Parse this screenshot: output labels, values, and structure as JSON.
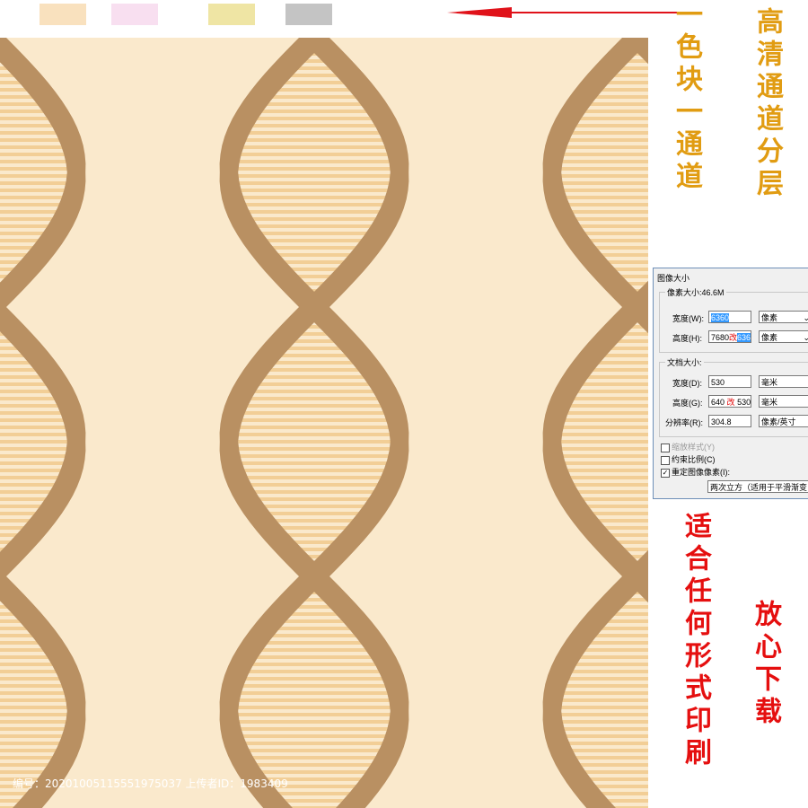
{
  "swatches": [
    {
      "name": "swatch-cream",
      "color": "#f9e1be"
    },
    {
      "name": "swatch-pink",
      "color": "#f8dff0"
    },
    {
      "name": "swatch-yellow",
      "color": "#efe5a4"
    },
    {
      "name": "swatch-gray",
      "color": "#c4c4c4"
    }
  ],
  "arrow_color": "#e0121a",
  "pattern": {
    "background": "#fae9cc",
    "band_color": "#b99062",
    "stripe_color": "#f1c98d"
  },
  "side_text": {
    "left_top": "一色块一通道",
    "right_top": "高清通道分层",
    "left_bottom": "适合任何形式印刷",
    "right_bottom": "放心下载",
    "gold_color": "#e19c12",
    "red_color": "#e50f0f"
  },
  "dialog": {
    "title": "图像大小",
    "pixel_dims_label": "像素大小:46.6M",
    "width_label": "宽度(W):",
    "width_value": "6360",
    "width_unit": "像素",
    "height_label": "高度(H):",
    "height_old": "7680",
    "height_arrow": "改",
    "height_value": "6360",
    "height_unit": "像素",
    "doc_size_label": "文档大小:",
    "doc_width_label": "宽度(D):",
    "doc_width_value": "530",
    "doc_width_unit": "毫米",
    "doc_height_label": "高度(G):",
    "doc_height_old": "640",
    "doc_height_arrow": "改",
    "doc_height_value": "530",
    "doc_height_unit": "毫米",
    "resolution_label": "分辨率(R):",
    "resolution_value": "304.8",
    "resolution_unit": "像素/英寸",
    "scale_styles": "缩放样式(Y)",
    "constrain": "约束比例(C)",
    "resample": "重定图像像素(I):",
    "resample_method": "两次立方（适用于平滑渐变"
  },
  "watermark": "编号：20201005115551975037 上传者ID：1983409"
}
